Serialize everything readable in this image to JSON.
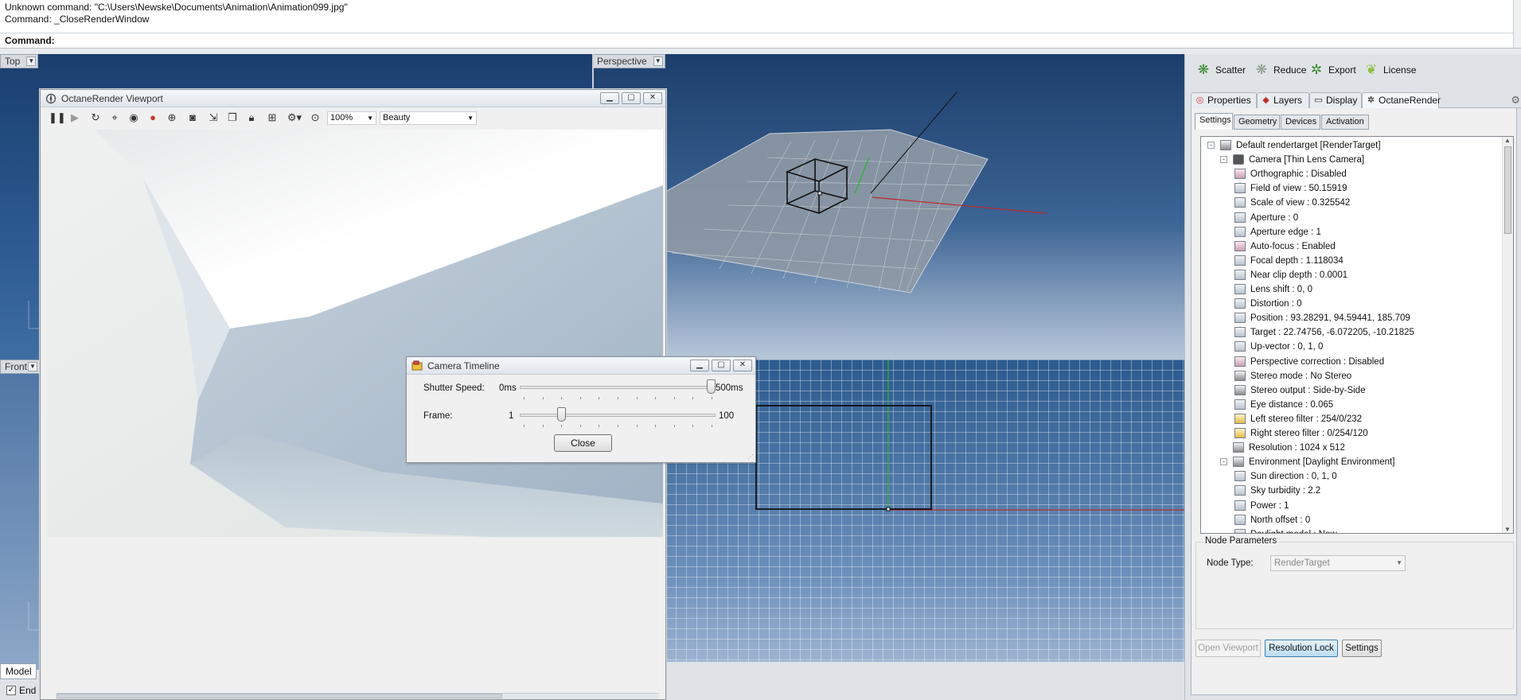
{
  "command_history": [
    "Unknown command: \"C:\\Users\\Newske\\Documents\\Animation\\Animation099.jpg\"",
    "Command: _CloseRenderWindow"
  ],
  "command_prompt": "Command:",
  "viewports": {
    "top": "Top",
    "front": "Front",
    "perspective": "Perspective"
  },
  "octane_window": {
    "title": "OctaneRender Viewport",
    "zoom": "100%",
    "pass": "Beauty"
  },
  "timeline": {
    "title": "Camera Timeline",
    "shutter_label": "Shutter Speed:",
    "shutter_min": "0ms",
    "shutter_max": "500ms",
    "shutter_value": 1.0,
    "frame_label": "Frame:",
    "frame_min": "1",
    "frame_max": "100",
    "frame_value": 21,
    "close_label": "Close"
  },
  "plugins": [
    {
      "label": "Scatter",
      "icon": "scatter-icon"
    },
    {
      "label": "Reduce",
      "icon": "reduce-icon"
    },
    {
      "label": "Export",
      "icon": "export-icon"
    },
    {
      "label": "License",
      "icon": "license-icon"
    }
  ],
  "panel_tabs": [
    {
      "label": "Properties",
      "icon": "properties-icon"
    },
    {
      "label": "Layers",
      "icon": "layers-icon"
    },
    {
      "label": "Display",
      "icon": "display-icon"
    },
    {
      "label": "OctaneRender",
      "icon": "octane-icon"
    }
  ],
  "sub_tabs": [
    "Settings",
    "Geometry",
    "Devices",
    "Activation"
  ],
  "tree": [
    {
      "label": "Default rendertarget  [RenderTarget]",
      "level": 0,
      "icon": "rendertarget-icon",
      "expander": "-"
    },
    {
      "label": "Camera  [Thin Lens Camera]",
      "level": 1,
      "icon": "camera-icon",
      "expander": "-"
    },
    {
      "label": "Orthographic : Disabled",
      "level": 2,
      "icon": "bool-param-icon"
    },
    {
      "label": "Field of view : 50.15919",
      "level": 2,
      "icon": "float-param-icon"
    },
    {
      "label": "Scale of view : 0.325542",
      "level": 2,
      "icon": "float-param-icon"
    },
    {
      "label": "Aperture : 0",
      "level": 2,
      "icon": "float-param-icon"
    },
    {
      "label": "Aperture edge : 1",
      "level": 2,
      "icon": "float-param-icon"
    },
    {
      "label": "Auto-focus : Enabled",
      "level": 2,
      "icon": "bool-param-icon"
    },
    {
      "label": "Focal depth : 1.118034",
      "level": 2,
      "icon": "float-param-icon"
    },
    {
      "label": "Near clip depth : 0.0001",
      "level": 2,
      "icon": "float-param-icon"
    },
    {
      "label": "Lens shift : 0, 0",
      "level": 2,
      "icon": "float-param-icon"
    },
    {
      "label": "Distortion : 0",
      "level": 2,
      "icon": "float-param-icon"
    },
    {
      "label": "Position : 93.28291, 94.59441, 185.709",
      "level": 2,
      "icon": "float-param-icon"
    },
    {
      "label": "Target : 22.74756, -6.072205, -10.21825",
      "level": 2,
      "icon": "float-param-icon"
    },
    {
      "label": "Up-vector : 0, 1, 0",
      "level": 2,
      "icon": "float-param-icon"
    },
    {
      "label": "Perspective correction : Disabled",
      "level": 2,
      "icon": "bool-param-icon"
    },
    {
      "label": "Stereo mode : No Stereo",
      "level": 2,
      "icon": "enum-param-icon"
    },
    {
      "label": "Stereo output : Side-by-Side",
      "level": 2,
      "icon": "enum-param-icon"
    },
    {
      "label": "Eye distance : 0.065",
      "level": 2,
      "icon": "float-param-icon"
    },
    {
      "label": "Left stereo filter : 254/0/232",
      "level": 2,
      "icon": "color-param-icon"
    },
    {
      "label": "Right stereo filter : 0/254/120",
      "level": 2,
      "icon": "color-param-icon"
    },
    {
      "label": "Resolution : 1024 x 512",
      "level": 1,
      "icon": "enum-param-icon"
    },
    {
      "label": "Environment  [Daylight Environment]",
      "level": 1,
      "icon": "environment-icon",
      "expander": "-"
    },
    {
      "label": "Sun direction : 0, 1, 0",
      "level": 2,
      "icon": "float-param-icon"
    },
    {
      "label": "Sky turbidity : 2.2",
      "level": 2,
      "icon": "float-param-icon"
    },
    {
      "label": "Power : 1",
      "level": 2,
      "icon": "float-param-icon"
    },
    {
      "label": "North offset : 0",
      "level": 2,
      "icon": "float-param-icon"
    },
    {
      "label": "Daylight model : New",
      "level": 2,
      "icon": "enum-param-icon"
    }
  ],
  "node_params": {
    "title": "Node Parameters",
    "type_label": "Node Type:",
    "type_value": "RenderTarget"
  },
  "buttons": {
    "open_viewport": "Open Viewport",
    "resolution_lock": "Resolution Lock",
    "settings": "Settings"
  },
  "left_bottom": {
    "model_tab": "Model",
    "end_label": "End"
  }
}
